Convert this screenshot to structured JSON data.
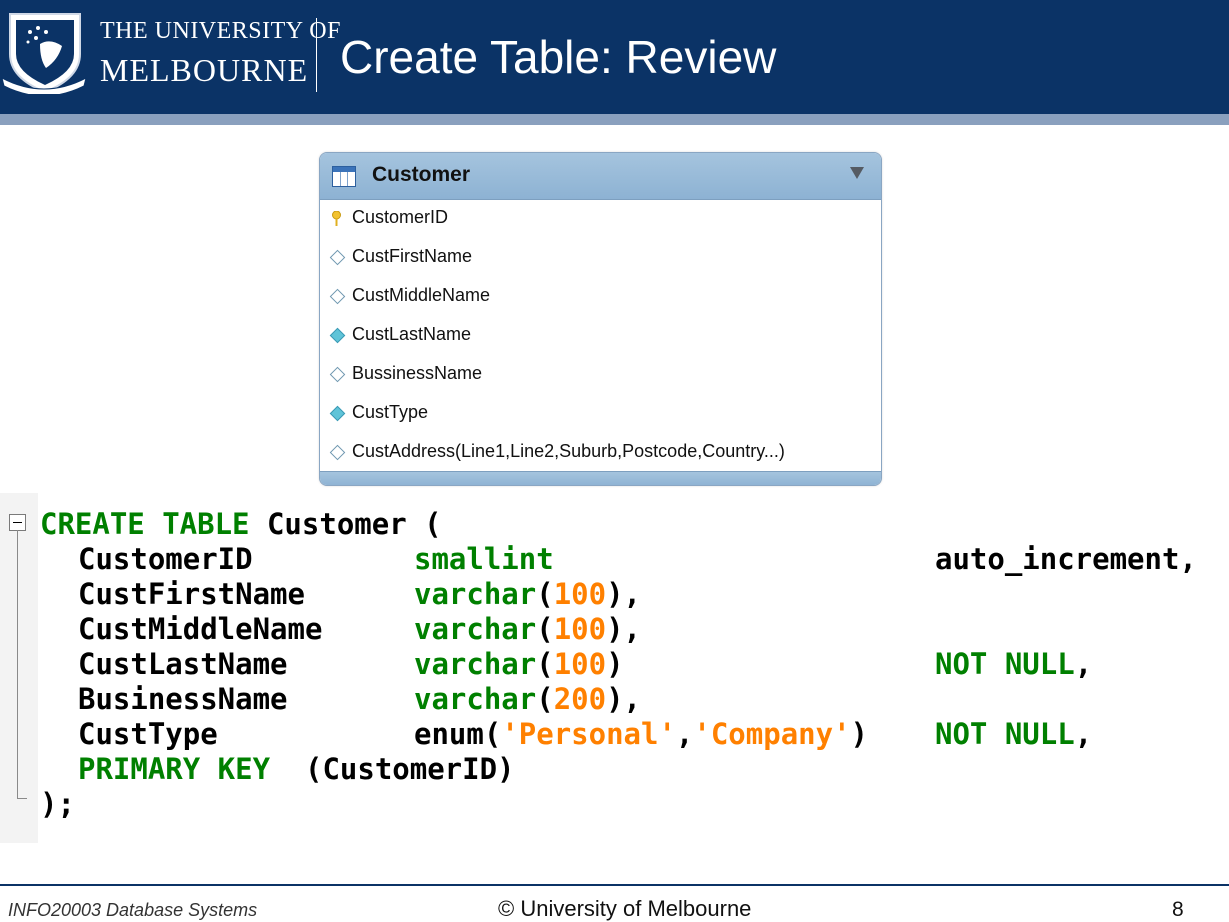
{
  "header": {
    "university_line1": "THE UNIVERSITY OF",
    "university_line2": "MELBOURNE",
    "slide_title": "Create Table: Review"
  },
  "er_table": {
    "name": "Customer",
    "columns": [
      {
        "label": "CustomerID",
        "icon": "key-icon"
      },
      {
        "label": "CustFirstName",
        "icon": "diamond-outline-icon"
      },
      {
        "label": "CustMiddleName",
        "icon": "diamond-outline-icon"
      },
      {
        "label": "CustLastName",
        "icon": "diamond-filled-icon"
      },
      {
        "label": "BussinessName",
        "icon": "diamond-outline-icon"
      },
      {
        "label": "CustType",
        "icon": "diamond-filled-icon"
      },
      {
        "label": "CustAddress(Line1,Line2,Suburb,Postcode,Country...)",
        "icon": "diamond-outline-icon"
      }
    ]
  },
  "code": {
    "line1_kw": "CREATE TABLE",
    "line1_rest": " Customer (",
    "rows": [
      {
        "name": "CustomerID",
        "type": "smallint",
        "arg": "",
        "after": "",
        "constraint": "",
        "suffix": "auto_increment,"
      },
      {
        "name": "CustFirstName",
        "type": "varchar",
        "arg": "100",
        "after": ",",
        "constraint": "",
        "suffix": ""
      },
      {
        "name": "CustMiddleName",
        "type": "varchar",
        "arg": "100",
        "after": ",",
        "constraint": "",
        "suffix": ""
      },
      {
        "name": "CustLastName",
        "type": "varchar",
        "arg": "100",
        "after": "",
        "constraint": "NOT NULL",
        "suffix": ","
      },
      {
        "name": "BusinessName",
        "type": "varchar",
        "arg": "200",
        "after": ",",
        "constraint": "",
        "suffix": ""
      },
      {
        "name": "CustType",
        "type": "enum",
        "arg1": "'Personal'",
        "arg2": "'Company'",
        "constraint": "NOT NULL",
        "suffix": ","
      }
    ],
    "pk_kw": "PRIMARY KEY",
    "pk_rest": "  (CustomerID)",
    "close": ");"
  },
  "footer": {
    "course": "INFO20003 Database Systems",
    "copyright": "© University of Melbourne",
    "page_number": "8"
  },
  "colors": {
    "header_bg": "#0b3366",
    "keyword_green": "#008000",
    "literal_orange": "#ff8000"
  }
}
